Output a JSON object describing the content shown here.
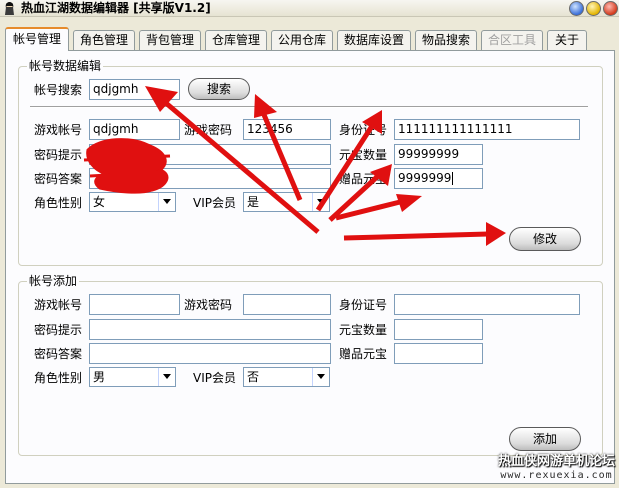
{
  "window": {
    "title": "热血江湖数据编辑器 [共享版V1.2]"
  },
  "tabs": [
    {
      "label": "帐号管理",
      "active": true
    },
    {
      "label": "角色管理"
    },
    {
      "label": "背包管理"
    },
    {
      "label": "仓库管理"
    },
    {
      "label": "公用仓库"
    },
    {
      "label": "数据库设置"
    },
    {
      "label": "物品搜索"
    },
    {
      "label": "合区工具",
      "disabled": true
    },
    {
      "label": "关于"
    }
  ],
  "edit": {
    "group_title": "帐号数据编辑",
    "search_label": "帐号搜索",
    "search_value": "qdjgmh",
    "search_button": "搜索",
    "account_label": "游戏帐号",
    "account_value": "qdjgmh",
    "password_label": "游戏密码",
    "password_value": "123456",
    "id_label": "身份证号",
    "id_value": "111111111111111",
    "hint_label": "密码提示",
    "hint_value": "",
    "yuanbao_label": "元宝数量",
    "yuanbao_value": "99999999",
    "answer_label": "密码答案",
    "answer_value": "",
    "gift_label": "赠品元宝",
    "gift_value": "9999999",
    "gender_label": "角色性别",
    "gender_value": "女",
    "vip_label": "VIP会员",
    "vip_value": "是",
    "modify_button": "修改"
  },
  "add": {
    "group_title": "帐号添加",
    "account_label": "游戏帐号",
    "password_label": "游戏密码",
    "id_label": "身份证号",
    "hint_label": "密码提示",
    "yuanbao_label": "元宝数量",
    "answer_label": "密码答案",
    "gift_label": "赠品元宝",
    "gender_label": "角色性别",
    "gender_value": "男",
    "vip_label": "VIP会员",
    "vip_value": "否",
    "add_button": "添加"
  },
  "watermark": {
    "line1": "热血侠网游单机论坛",
    "line2": "www.rexuexia.com"
  },
  "annotation_color": "#e01010",
  "icons": {
    "app": "app-icon",
    "minimize": "minimize-icon",
    "maximize": "maximize-icon",
    "close": "close-icon",
    "dropdown": "chevron-down-icon"
  }
}
